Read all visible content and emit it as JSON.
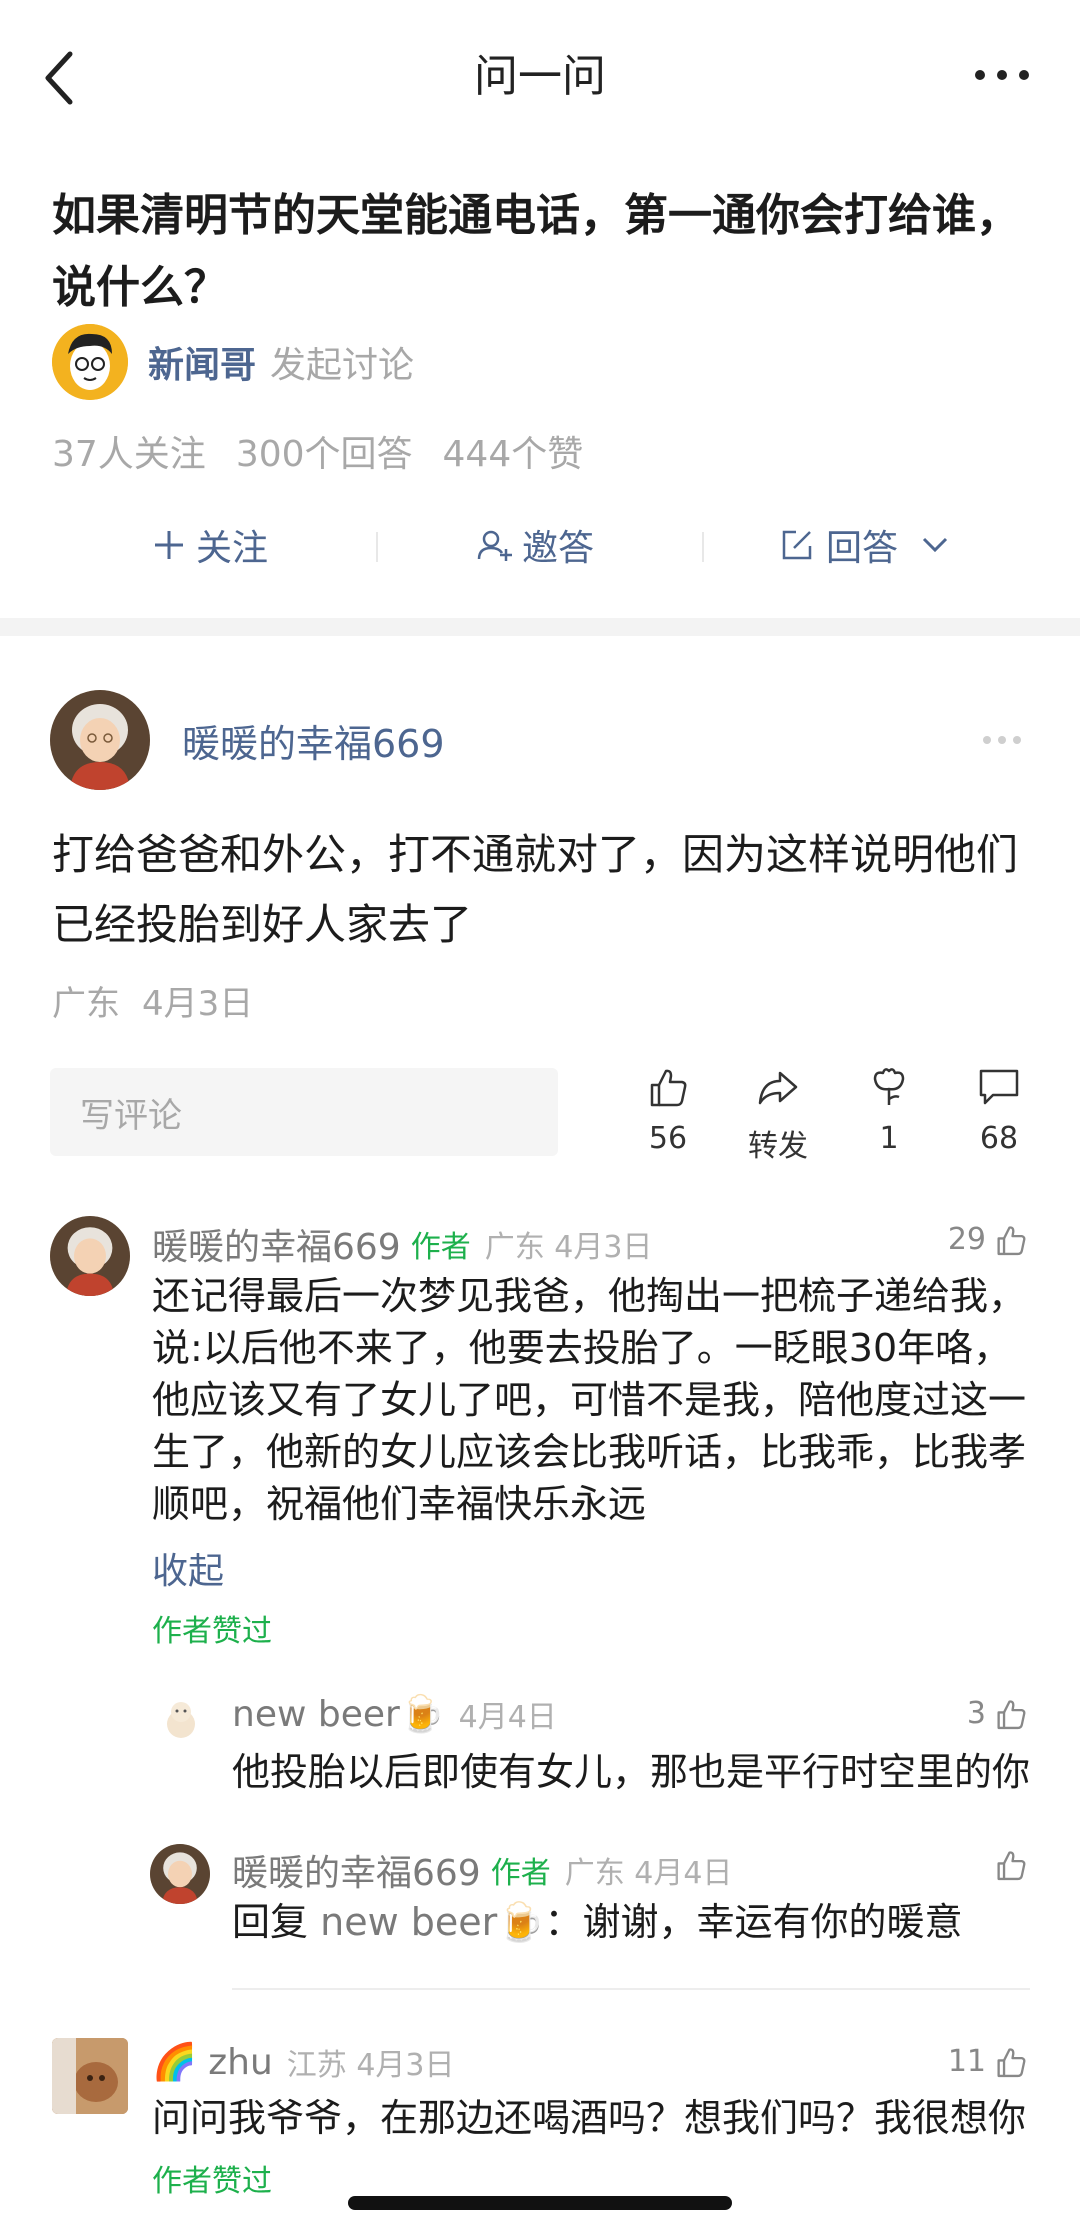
{
  "nav": {
    "title": "问一问"
  },
  "question": {
    "title": "如果清明节的天堂能通电话，第一通你会打给谁，说什么？",
    "author": "新闻哥",
    "author_action": "发起讨论",
    "stats": [
      "37人关注",
      "300个回答",
      "444个赞"
    ]
  },
  "actions": {
    "follow": "关注",
    "invite": "邀答",
    "answer": "回答"
  },
  "answer": {
    "author": "暖暖的幸福669",
    "content": "打给爸爸和外公，打不通就对了，因为这样说明他们已经投胎到好人家去了",
    "location": "广东",
    "date": "4月3日",
    "comment_placeholder": "写评论",
    "like_count": "56",
    "repost_label": "转发",
    "cheer_count": "1",
    "comment_count": "68"
  },
  "comments": [
    {
      "name": "暖暖的幸福669",
      "tag": "作者",
      "location": "广东 4月3日",
      "likes": "29",
      "text": "还记得最后一次梦见我爸，他掏出一把梳子递给我，说:以后他不来了，他要去投胎了。一眨眼30年咯，他应该又有了女儿了吧，可惜不是我，陪他度过这一生了，他新的女儿应该会比我听话，比我乖，比我孝顺吧，祝福他们幸福快乐永远",
      "collapse": "收起",
      "liked": "作者赞过"
    }
  ],
  "replies": [
    {
      "name": "new beer🍺",
      "date": "4月4日",
      "likes": "3",
      "text": "他投胎以后即使有女儿，那也是平行时空里的你"
    },
    {
      "name": "暖暖的幸福669",
      "tag": "作者",
      "location": "广东 4月4日",
      "text_prefix": "回复",
      "text_target": "new beer🍺",
      "text_body": "：谢谢，幸运有你的暖意"
    }
  ],
  "comment2": {
    "name": "🌈 zhu",
    "location": "江苏 4月3日",
    "likes": "11",
    "text": "问问我爷爷，在那边还喝酒吗？想我们吗？我很想你",
    "liked": "作者赞过"
  }
}
